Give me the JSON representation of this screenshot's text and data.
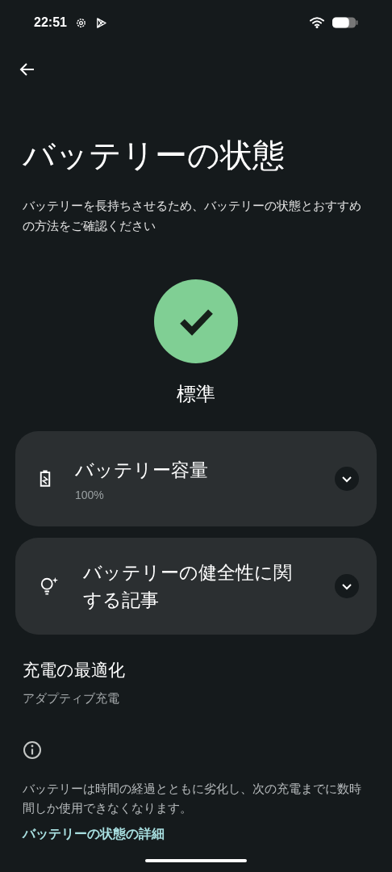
{
  "status_bar": {
    "time": "22:51"
  },
  "title": "バッテリーの状態",
  "description": "バッテリーを長持ちさせるため、バッテリーの状態とおすすめの方法をご確認ください",
  "status": {
    "label": "標準",
    "kind": "good"
  },
  "cards": [
    {
      "kind": "capacity",
      "title": "バッテリー容量",
      "subtitle": "100%",
      "expanded": false
    },
    {
      "kind": "article",
      "title": "バッテリーの健全性に関する記事",
      "expanded": false
    }
  ],
  "charging": {
    "title": "充電の最適化",
    "subtitle": "アダプティブ充電"
  },
  "info": {
    "text": "バッテリーは時間の経過とともに劣化し、次の充電までに数時間しか使用できなくなります。",
    "link": "バッテリーの状態の詳細"
  }
}
